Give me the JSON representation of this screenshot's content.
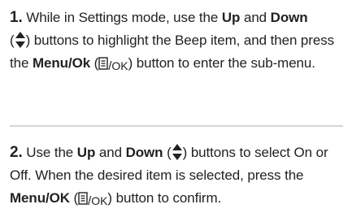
{
  "step1": {
    "number": "1.",
    "text1": " While in Settings mode, use the ",
    "up_label": "Up",
    "and": " and ",
    "down_label": "Down",
    "paren_open": " (",
    "paren_close": ") buttons to highlight the Beep item, and then press the ",
    "menu_ok_label": "Menu/Ok",
    "paren_open2": " (",
    "paren_close2": ") button to enter the sub-menu.",
    "icon_ok_text": "OK"
  },
  "step2": {
    "number": "2.",
    "text1": " Use the ",
    "up_label": "Up",
    "and": " and ",
    "down_label": "Down",
    "paren_open": " (",
    "paren_close": ") buttons to select On or Off. When the desired item is selected, press the ",
    "menu_ok_label": "Menu/OK",
    "paren_open2": " (",
    "paren_close2": ") button to confirm.",
    "icon_ok_text": "OK"
  },
  "colors": {
    "text": "#222222",
    "divider": "#d6d6d6"
  }
}
